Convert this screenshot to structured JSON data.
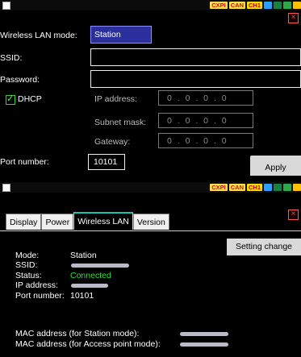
{
  "panel1": {
    "statusbar": {
      "tags": [
        "CXPI",
        "CAN",
        "CH1"
      ],
      "icons": [
        "usb-icon",
        "network-icon",
        "card-icon",
        "power-icon"
      ]
    },
    "close_glyph": "×",
    "wireless_lan_mode": {
      "label": "Wireless LAN mode:",
      "value": "Station"
    },
    "ssid": {
      "label": "SSID:",
      "value": ""
    },
    "password": {
      "label": "Password:",
      "value": ""
    },
    "dhcp": {
      "label": "DHCP",
      "checked": true
    },
    "ip_address": {
      "label": "IP address:",
      "value": "0 . 0 . 0 . 0"
    },
    "subnet_mask": {
      "label": "Subnet mask:",
      "value": "0 . 0 . 0 . 0"
    },
    "gateway": {
      "label": "Gateway:",
      "value": "0 . 0 . 0 . 0"
    },
    "port_number": {
      "label": "Port number:",
      "value": "10101"
    },
    "apply_label": "Apply"
  },
  "panel2": {
    "statusbar": {
      "tags": [
        "CXPI",
        "CAN",
        "CH1"
      ],
      "icons": [
        "usb-icon",
        "network-icon",
        "card-icon",
        "power-icon"
      ]
    },
    "close_glyph": "×",
    "tabs": [
      {
        "label": "Display",
        "active": false
      },
      {
        "label": "Power",
        "active": false
      },
      {
        "label": "Wireless LAN",
        "active": true
      },
      {
        "label": "Version",
        "active": false
      }
    ],
    "setting_change_label": "Setting change",
    "info": {
      "mode": {
        "label": "Mode:",
        "value": "Station"
      },
      "ssid": {
        "label": "SSID:"
      },
      "status": {
        "label": "Status:",
        "value": "Connected"
      },
      "ip_address": {
        "label": "IP address:"
      },
      "port_number": {
        "label": "Port number:",
        "value": "10101"
      },
      "mac_station": {
        "label": "MAC address (for Station mode):"
      },
      "mac_ap": {
        "label": "MAC address (for Access point mode):"
      }
    },
    "colors": {
      "connected": "#2fe02f",
      "tab_accent": "#19c0b0"
    }
  }
}
